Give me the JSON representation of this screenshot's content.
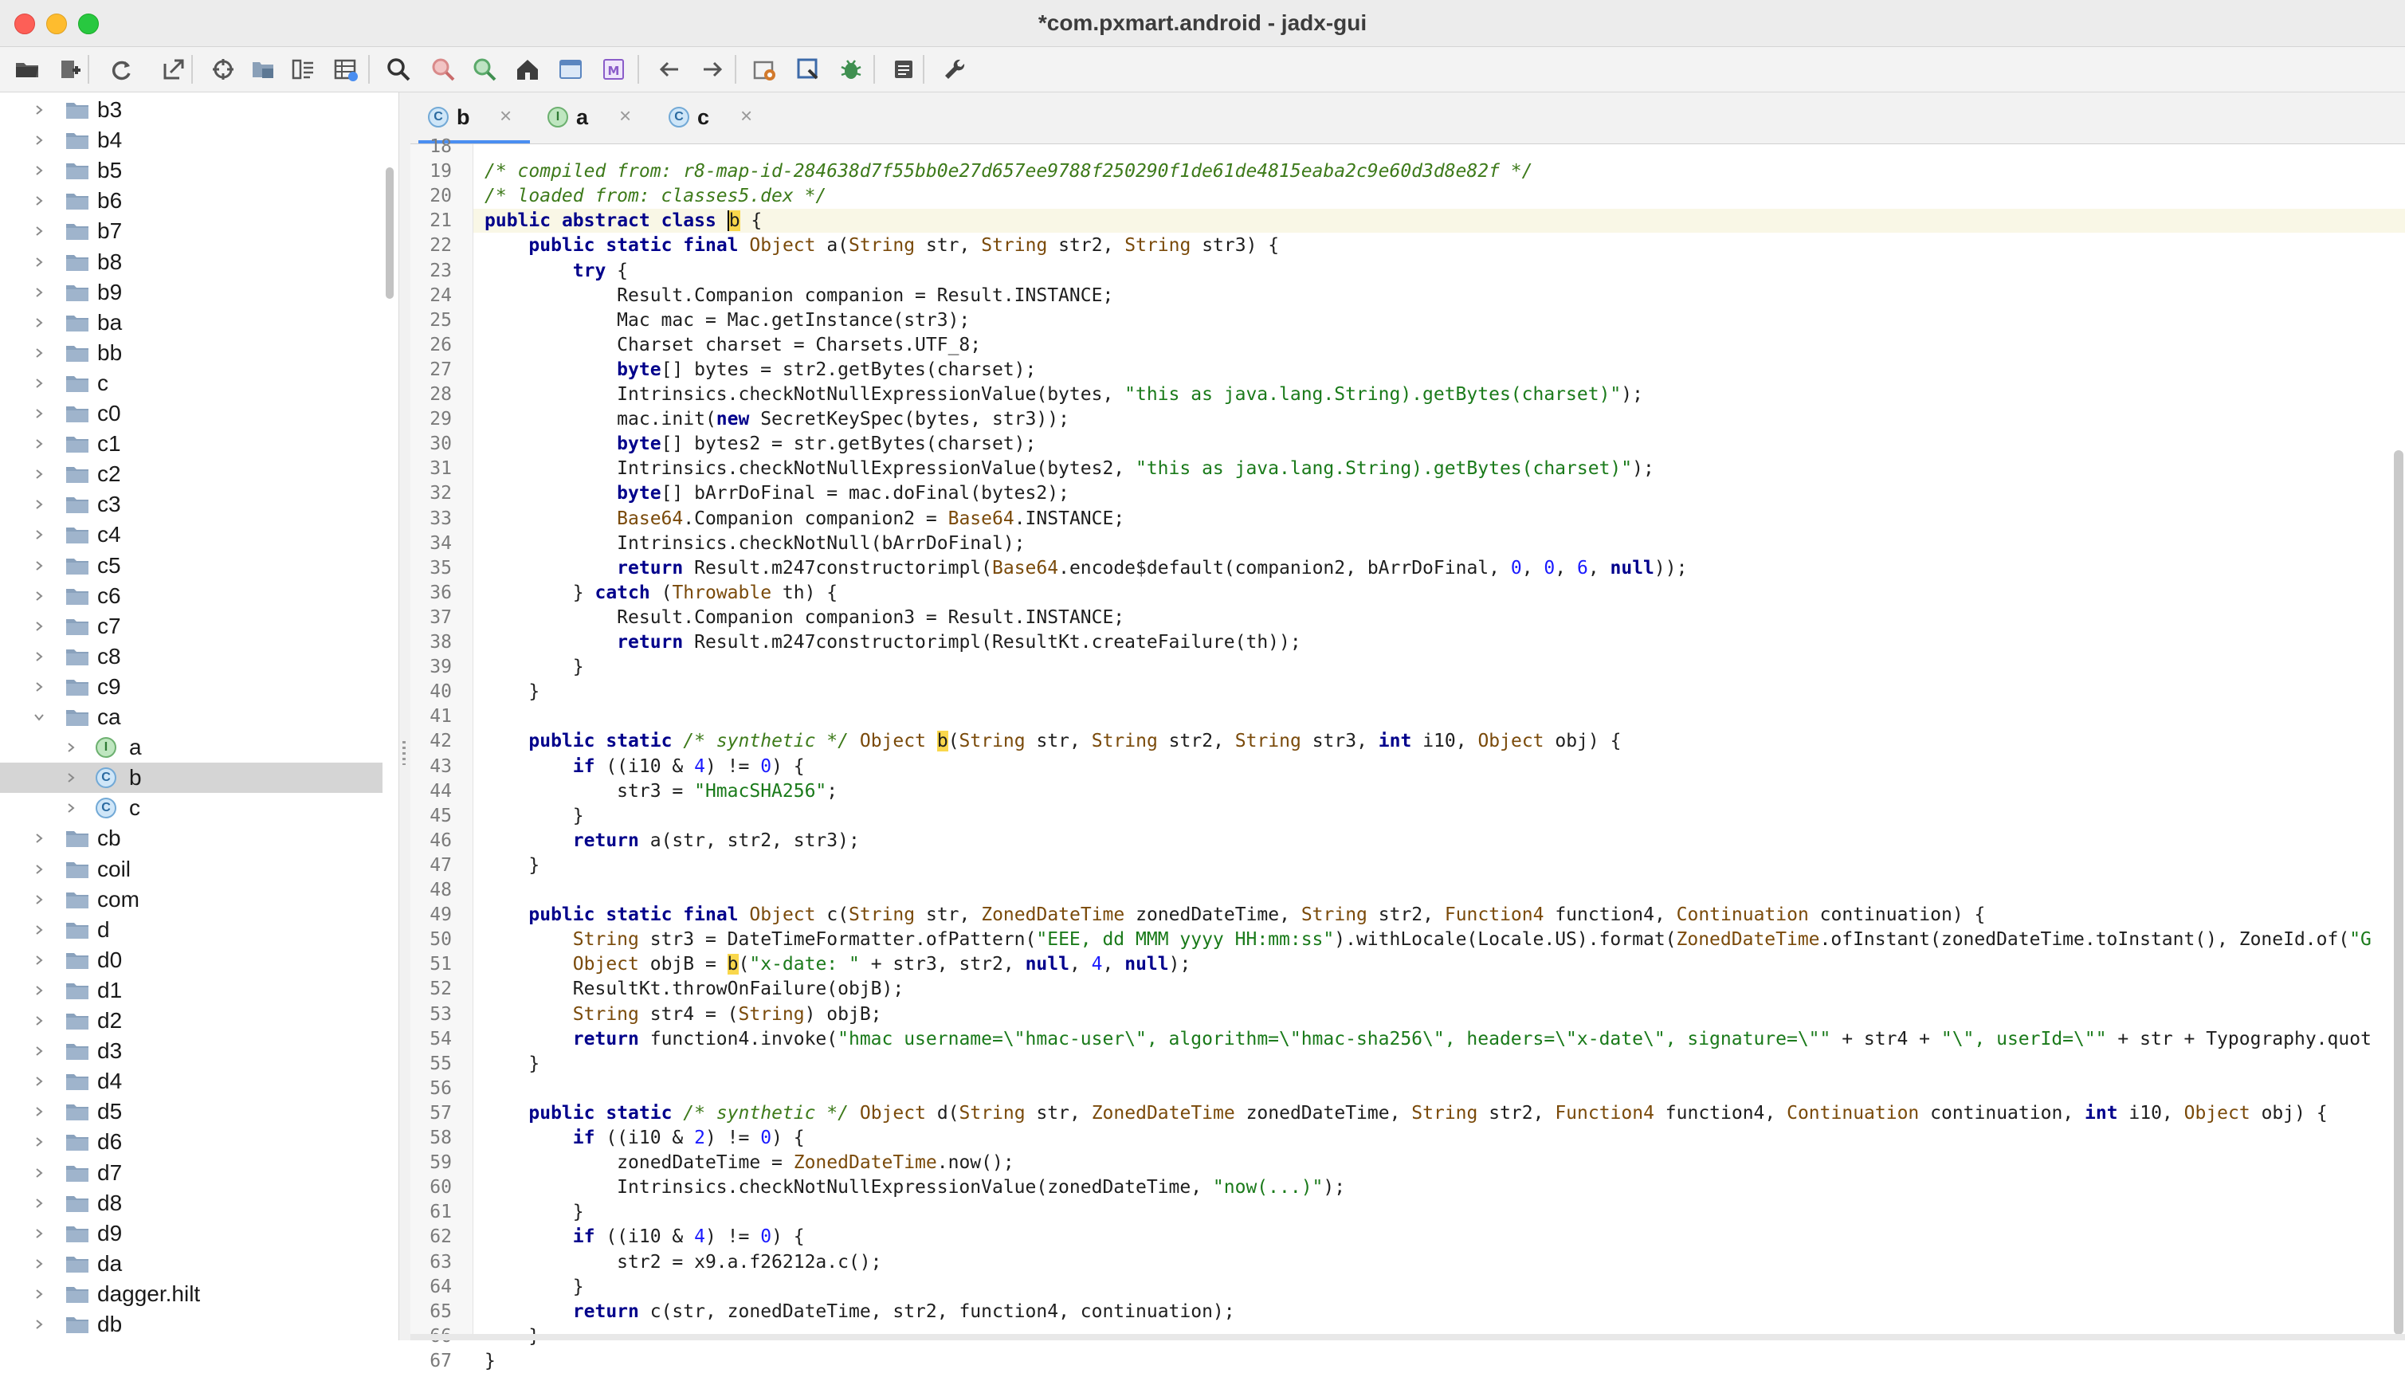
{
  "window": {
    "title": "*com.pxmart.android - jadx-gui",
    "colors": {
      "close": "#fd5f57",
      "minimize": "#febc2e",
      "maximize": "#28c840",
      "accent": "#4a8ef1",
      "selection": "#d5d5d5"
    }
  },
  "toolbar": {
    "buttons": [
      {
        "icon": "open-folder-icon"
      },
      {
        "icon": "add-files-icon"
      },
      {
        "icon": "reload-icon"
      },
      {
        "icon": "export-icon"
      },
      {
        "icon": "sync-tree-icon"
      },
      {
        "icon": "flatten-packages-icon"
      },
      {
        "icon": "show-code-icon"
      },
      {
        "icon": "smali-table-icon"
      },
      {
        "icon": "search-icon"
      },
      {
        "icon": "class-search-icon"
      },
      {
        "icon": "comment-search-icon"
      },
      {
        "icon": "home-icon"
      },
      {
        "icon": "deobfuscation-icon"
      },
      {
        "icon": "quark-icon"
      },
      {
        "icon": "back-icon"
      },
      {
        "icon": "forward-icon"
      },
      {
        "icon": "preferences-icon"
      },
      {
        "icon": "decompile-all-icon"
      },
      {
        "icon": "debugger-icon"
      },
      {
        "icon": "log-viewer-icon"
      },
      {
        "icon": "settings-wrench-icon"
      }
    ]
  },
  "tree": {
    "items": [
      {
        "label": "b3",
        "kind": "package",
        "indent": 0
      },
      {
        "label": "b4",
        "kind": "package",
        "indent": 0
      },
      {
        "label": "b5",
        "kind": "package",
        "indent": 0
      },
      {
        "label": "b6",
        "kind": "package",
        "indent": 0
      },
      {
        "label": "b7",
        "kind": "package",
        "indent": 0
      },
      {
        "label": "b8",
        "kind": "package",
        "indent": 0
      },
      {
        "label": "b9",
        "kind": "package",
        "indent": 0
      },
      {
        "label": "ba",
        "kind": "package",
        "indent": 0
      },
      {
        "label": "bb",
        "kind": "package",
        "indent": 0
      },
      {
        "label": "c",
        "kind": "package",
        "indent": 0
      },
      {
        "label": "c0",
        "kind": "package",
        "indent": 0
      },
      {
        "label": "c1",
        "kind": "package",
        "indent": 0
      },
      {
        "label": "c2",
        "kind": "package",
        "indent": 0
      },
      {
        "label": "c3",
        "kind": "package",
        "indent": 0
      },
      {
        "label": "c4",
        "kind": "package",
        "indent": 0
      },
      {
        "label": "c5",
        "kind": "package",
        "indent": 0
      },
      {
        "label": "c6",
        "kind": "package",
        "indent": 0
      },
      {
        "label": "c7",
        "kind": "package",
        "indent": 0
      },
      {
        "label": "c8",
        "kind": "package",
        "indent": 0
      },
      {
        "label": "c9",
        "kind": "package",
        "indent": 0
      },
      {
        "label": "ca",
        "kind": "package",
        "indent": 0,
        "expanded": true
      },
      {
        "label": "a",
        "kind": "interface",
        "indent": 1,
        "badge": "I"
      },
      {
        "label": "b",
        "kind": "class",
        "indent": 1,
        "badge": "C",
        "selected": true
      },
      {
        "label": "c",
        "kind": "class",
        "indent": 1,
        "badge": "C"
      },
      {
        "label": "cb",
        "kind": "package",
        "indent": 0
      },
      {
        "label": "coil",
        "kind": "package",
        "indent": 0
      },
      {
        "label": "com",
        "kind": "package",
        "indent": 0
      },
      {
        "label": "d",
        "kind": "package",
        "indent": 0
      },
      {
        "label": "d0",
        "kind": "package",
        "indent": 0
      },
      {
        "label": "d1",
        "kind": "package",
        "indent": 0
      },
      {
        "label": "d2",
        "kind": "package",
        "indent": 0
      },
      {
        "label": "d3",
        "kind": "package",
        "indent": 0
      },
      {
        "label": "d4",
        "kind": "package",
        "indent": 0
      },
      {
        "label": "d5",
        "kind": "package",
        "indent": 0
      },
      {
        "label": "d6",
        "kind": "package",
        "indent": 0
      },
      {
        "label": "d7",
        "kind": "package",
        "indent": 0
      },
      {
        "label": "d8",
        "kind": "package",
        "indent": 0
      },
      {
        "label": "d9",
        "kind": "package",
        "indent": 0
      },
      {
        "label": "da",
        "kind": "package",
        "indent": 0
      },
      {
        "label": "dagger.hilt",
        "kind": "package",
        "indent": 0
      },
      {
        "label": "db",
        "kind": "package",
        "indent": 0
      }
    ]
  },
  "tabs": [
    {
      "label": "b",
      "badge": "C",
      "close": "×",
      "active": true
    },
    {
      "label": "a",
      "badge": "I",
      "close": "×",
      "active": false
    },
    {
      "label": "c",
      "badge": "C",
      "close": "×",
      "active": false
    }
  ],
  "editor": {
    "lines": [
      {
        "n": "18",
        "code": ""
      },
      {
        "n": "19",
        "code": "/* compiled from: r8-map-id-284638d7f55bb0e27d657ee9788f250290f1de61de4815eaba2c9e60d3d8e82f */"
      },
      {
        "n": "20",
        "code": "/* loaded from: classes5.dex */"
      },
      {
        "n": "21",
        "code": "public abstract class b {"
      },
      {
        "n": "22",
        "code": "    public static final Object a(String str, String str2, String str3) {"
      },
      {
        "n": "23",
        "code": "        try {"
      },
      {
        "n": "24",
        "code": "            Result.Companion companion = Result.INSTANCE;"
      },
      {
        "n": "25",
        "code": "            Mac mac = Mac.getInstance(str3);"
      },
      {
        "n": "26",
        "code": "            Charset charset = Charsets.UTF_8;"
      },
      {
        "n": "27",
        "code": "            byte[] bytes = str2.getBytes(charset);"
      },
      {
        "n": "28",
        "code": "            Intrinsics.checkNotNullExpressionValue(bytes, \"this as java.lang.String).getBytes(charset)\");"
      },
      {
        "n": "29",
        "code": "            mac.init(new SecretKeySpec(bytes, str3));"
      },
      {
        "n": "30",
        "code": "            byte[] bytes2 = str.getBytes(charset);"
      },
      {
        "n": "31",
        "code": "            Intrinsics.checkNotNullExpressionValue(bytes2, \"this as java.lang.String).getBytes(charset)\");"
      },
      {
        "n": "32",
        "code": "            byte[] bArrDoFinal = mac.doFinal(bytes2);"
      },
      {
        "n": "33",
        "code": "            Base64.Companion companion2 = Base64.INSTANCE;"
      },
      {
        "n": "34",
        "code": "            Intrinsics.checkNotNull(bArrDoFinal);"
      },
      {
        "n": "35",
        "code": "            return Result.m247constructorimpl(Base64.encode$default(companion2, bArrDoFinal, 0, 0, 6, null));"
      },
      {
        "n": "36",
        "code": "        } catch (Throwable th) {"
      },
      {
        "n": "37",
        "code": "            Result.Companion companion3 = Result.INSTANCE;"
      },
      {
        "n": "38",
        "code": "            return Result.m247constructorimpl(ResultKt.createFailure(th));"
      },
      {
        "n": "39",
        "code": "        }"
      },
      {
        "n": "40",
        "code": "    }"
      },
      {
        "n": "41",
        "code": ""
      },
      {
        "n": "42",
        "code": "    public static /* synthetic */ Object b(String str, String str2, String str3, int i10, Object obj) {"
      },
      {
        "n": "43",
        "code": "        if ((i10 & 4) != 0) {"
      },
      {
        "n": "44",
        "code": "            str3 = \"HmacSHA256\";"
      },
      {
        "n": "45",
        "code": "        }"
      },
      {
        "n": "46",
        "code": "        return a(str, str2, str3);"
      },
      {
        "n": "47",
        "code": "    }"
      },
      {
        "n": "48",
        "code": ""
      },
      {
        "n": "49",
        "code": "    public static final Object c(String str, ZonedDateTime zonedDateTime, String str2, Function4 function4, Continuation continuation) {"
      },
      {
        "n": "50",
        "code": "        String str3 = DateTimeFormatter.ofPattern(\"EEE, dd MMM yyyy HH:mm:ss\").withLocale(Locale.US).format(ZonedDateTime.ofInstant(zonedDateTime.toInstant(), ZoneId.of(\"G"
      },
      {
        "n": "51",
        "code": "        Object objB = b(\"x-date: \" + str3, str2, null, 4, null);"
      },
      {
        "n": "52",
        "code": "        ResultKt.throwOnFailure(objB);"
      },
      {
        "n": "53",
        "code": "        String str4 = (String) objB;"
      },
      {
        "n": "54",
        "code": "        return function4.invoke(\"hmac username=\\\"hmac-user\\\", algorithm=\\\"hmac-sha256\\\", headers=\\\"x-date\\\", signature=\\\"\" + str4 + \"\\\", userId=\\\"\" + str + Typography.quot"
      },
      {
        "n": "55",
        "code": "    }"
      },
      {
        "n": "56",
        "code": ""
      },
      {
        "n": "57",
        "code": "    public static /* synthetic */ Object d(String str, ZonedDateTime zonedDateTime, String str2, Function4 function4, Continuation continuation, int i10, Object obj) {"
      },
      {
        "n": "58",
        "code": "        if ((i10 & 2) != 0) {"
      },
      {
        "n": "59",
        "code": "            zonedDateTime = ZonedDateTime.now();"
      },
      {
        "n": "60",
        "code": "            Intrinsics.checkNotNullExpressionValue(zonedDateTime, \"now(...)\");"
      },
      {
        "n": "61",
        "code": "        }"
      },
      {
        "n": "62",
        "code": "        if ((i10 & 4) != 0) {"
      },
      {
        "n": "63",
        "code": "            str2 = x9.a.f26212a.c();"
      },
      {
        "n": "64",
        "code": "        }"
      },
      {
        "n": "65",
        "code": "        return c(str, zonedDateTime, str2, function4, continuation);"
      },
      {
        "n": "66",
        "code": "    }"
      },
      {
        "n": "67",
        "code": "}"
      }
    ]
  }
}
